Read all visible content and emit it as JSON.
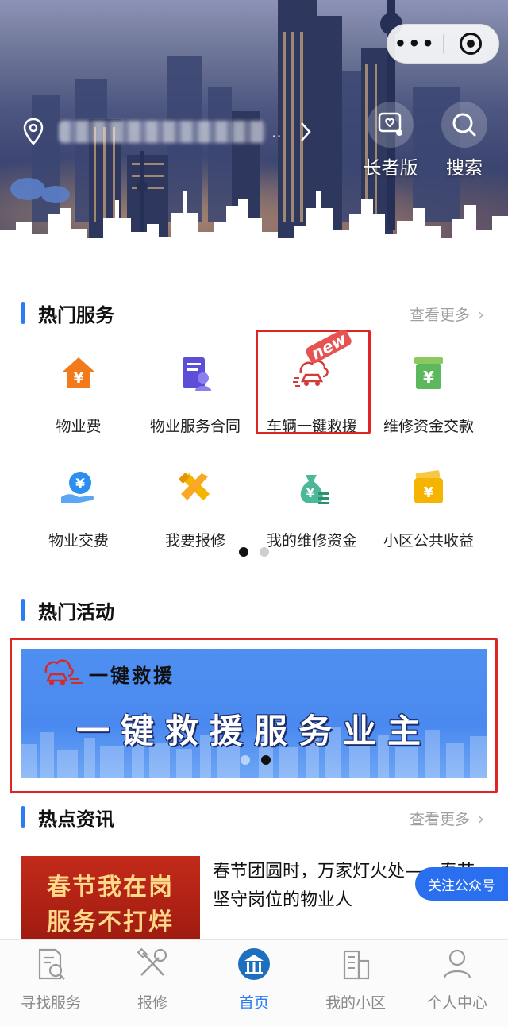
{
  "hero": {
    "capsule": {
      "more_icon": "more-dots-icon",
      "close_icon": "target-circle-icon"
    },
    "location": {
      "address": "",
      "truncation": "..",
      "pin_icon": "location-pin-icon",
      "chevron_icon": "chevron-right-icon"
    },
    "elder_label": "长者版",
    "search_label": "搜索"
  },
  "hot_services": {
    "title": "热门服务",
    "see_more": "查看更多",
    "new_badge": "new",
    "items": [
      {
        "label": "物业费",
        "icon": "house-yen-icon"
      },
      {
        "label": "物业服务合同",
        "icon": "contract-icon"
      },
      {
        "label": "车辆一键救援",
        "icon": "car-rescue-icon"
      },
      {
        "label": "维修资金交款",
        "icon": "fund-deposit-icon"
      },
      {
        "label": "物业交费",
        "icon": "hand-coin-icon"
      },
      {
        "label": "我要报修",
        "icon": "repair-tools-icon"
      },
      {
        "label": "我的维修资金",
        "icon": "money-bag-icon"
      },
      {
        "label": "小区公共收益",
        "icon": "wallet-yen-icon"
      }
    ]
  },
  "hot_activities": {
    "title": "热门活动",
    "banner": {
      "subtitle": "一键救援",
      "headline": "一键救援服务业主"
    }
  },
  "hot_news": {
    "title": "热点资讯",
    "see_more": "查看更多",
    "article": {
      "image_line1": "春节我在岗",
      "image_line2": "服务不打烊",
      "title": "春节团圆时，万家灯火处——春节坚守岗位的物业人"
    },
    "follow_button": "关注公众号"
  },
  "tabbar": [
    {
      "label": "寻找服务",
      "icon": "find-service-icon",
      "active": false
    },
    {
      "label": "报修",
      "icon": "repair-icon",
      "active": false
    },
    {
      "label": "首页",
      "icon": "home-icon",
      "active": true
    },
    {
      "label": "我的小区",
      "icon": "building-icon",
      "active": false
    },
    {
      "label": "个人中心",
      "icon": "person-icon",
      "active": false
    }
  ],
  "colors": {
    "accent": "#2a7cf6",
    "highlight_border": "#e02424",
    "orange": "#f27a1a",
    "green": "#5cb85c",
    "yellow": "#f4b400"
  }
}
